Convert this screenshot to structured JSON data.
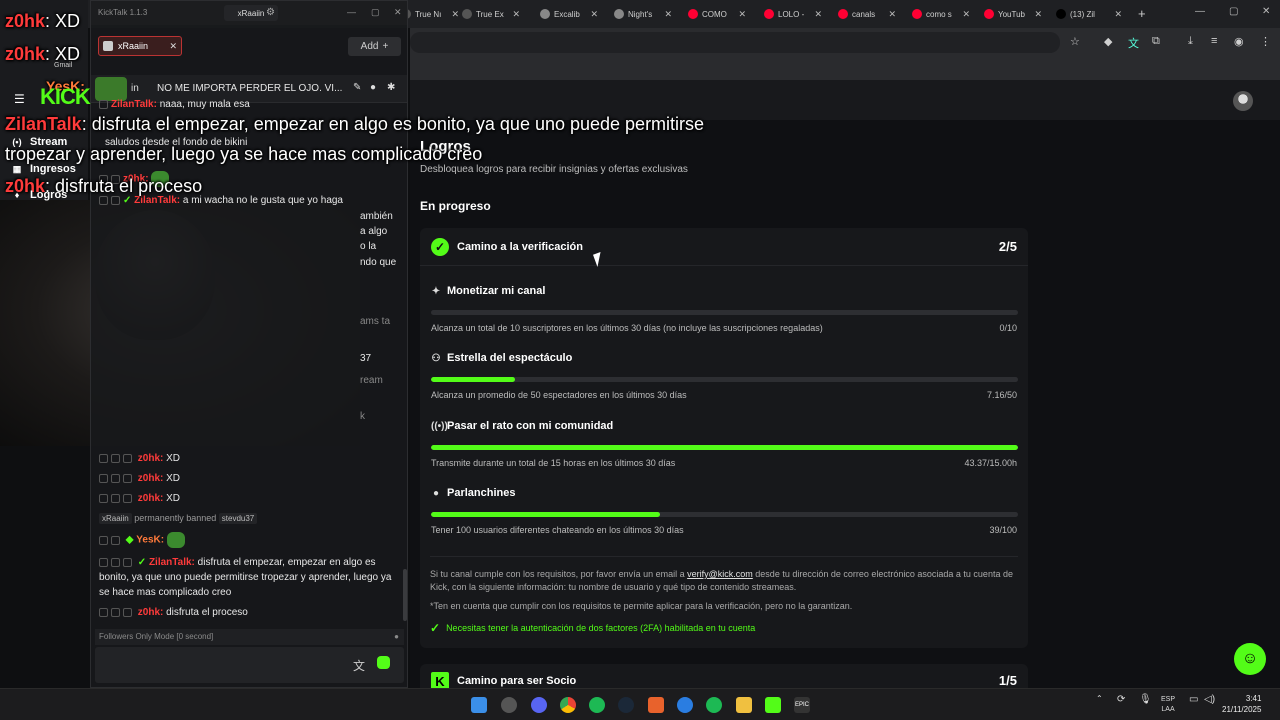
{
  "browser": {
    "tabs": [
      {
        "label": "True Nı",
        "icon": "page-icon",
        "color": "#555"
      },
      {
        "label": "True Ex",
        "icon": "page-icon",
        "color": "#555"
      },
      {
        "label": "Excalib",
        "icon": "page-icon",
        "color": "#888"
      },
      {
        "label": "Night's",
        "icon": "page-icon",
        "color": "#888"
      },
      {
        "label": "COMO",
        "icon": "youtube-icon",
        "color": "#ff0033"
      },
      {
        "label": "LOLO -",
        "icon": "youtube-icon",
        "color": "#ff0033"
      },
      {
        "label": "canals",
        "icon": "youtube-icon",
        "color": "#ff0033"
      },
      {
        "label": "como s",
        "icon": "youtube-icon",
        "color": "#ff0033"
      },
      {
        "label": "YouTub",
        "icon": "youtube-icon",
        "color": "#ff0033"
      },
      {
        "label": "(13) Zil",
        "icon": "x-icon",
        "color": "#000000"
      }
    ],
    "new_tab": "+"
  },
  "kick_page": {
    "title": "Logros",
    "subtitle": "Desbloquea logros para recibir insignias y ofertas exclusivas",
    "section": "En progreso",
    "card": {
      "title": "Camino a la verificación",
      "count": "2/5",
      "achievements": [
        {
          "icon": "sparkle-icon",
          "glyph": "✦",
          "title": "Monetizar mi canal",
          "desc": "Alcanza un total de 10 suscriptores en los últimos 30 días (no incluye las suscripciones regaladas)",
          "value": "0/10",
          "progress": 0.0
        },
        {
          "icon": "users-icon",
          "glyph": "⚇",
          "title": "Estrella del espectáculo",
          "desc": "Alcanza un promedio de 50 espectadores en los últimos 30 días",
          "value": "7.16/50",
          "progress": 0.1432
        },
        {
          "icon": "broadcast-icon",
          "glyph": "((•))",
          "title": "Pasar el rato con mi comunidad",
          "desc": "Transmite durante un total de 15 horas en los últimos 30 días",
          "value": "43.37/15.00h",
          "progress": 1.0
        },
        {
          "icon": "chat-icon",
          "glyph": "●",
          "title": "Parlanchines",
          "desc": "Tener 100 usuarios diferentes chateando en los últimos 30 días",
          "value": "39/100",
          "progress": 0.39
        }
      ],
      "info_1a": "Si tu canal cumple con los requisitos, por favor envía un email a ",
      "info_email": "verify@kick.com",
      "info_1b": " desde tu dirección de correo electrónico asociada a tu cuenta de Kick, con la siguiente información: tu nombre de usuario y qué tipo de contenido streameas.",
      "info_2": "*Ten en cuenta que cumplir con los requisitos te permite aplicar para la verificación, pero no la garantizan.",
      "twofa": "Necesitas tener la autenticación de dos factores (2FA) habilitada en tu cuenta"
    },
    "card2": {
      "title": "Camino para ser Socio",
      "count": "1/5"
    },
    "accent": "#53fc18"
  },
  "kicktalk": {
    "version": "KickTalk 1.1.3",
    "user_tab": "xRaaiin",
    "channel_tab": "xRaaiin",
    "add_label": "Add",
    "pinned": "NO ME IMPORTA PERDER EL OJO. VI...",
    "pinned_prefix": "in",
    "messages": {
      "m1_user": "ZilanTalk:",
      "m1_text": "naaa, muy mala esa",
      "m2_text": "saludos desde el fondo de bikini",
      "m3_user": "z0hk:",
      "m4_user": "ZilanTalk:",
      "m4_text": "a mi wacha no le gusta que yo haga",
      "frag_1": "ambién",
      "frag_2": "a algo",
      "frag_3": "o la",
      "frag_4": "ndo que",
      "frag_5": "ams ta",
      "frag_6": "37",
      "frag_7": "ream",
      "frag_8": "k",
      "xd_user": "z0hk:",
      "xd_text": "XD",
      "ban_mod": "xRaaiin",
      "ban_text": "permanently banned",
      "ban_target": "stevdu37",
      "yesk_user": "YesK:",
      "zt_user": "ZilanTalk:",
      "zt_text": "disfruta el empezar, empezar en algo es bonito, ya que uno puede permitirse tropezar y aprender, luego ya se hace mas complicado creo",
      "last_user": "z0hk:",
      "last_text": "disfruta el proceso"
    },
    "input_hint": "Followers Only Mode [0 second]"
  },
  "overlay": {
    "xd1_user": "z0hk",
    "xd1_text": ": XD",
    "xd2_user": "z0hk",
    "xd2_text": ": XD",
    "gmail": "Gmail",
    "yesk": "YesK:",
    "kick": "KICK",
    "zilan_user": "ZilanTalk",
    "zilan_text": ": disfruta el empezar, empezar en algo es bonito, ya que uno puede permitirse",
    "zilan_text2": "tropezar y aprender, luego ya se hace mas complicado creo",
    "last_user": "z0hk",
    "last_text": ": disfruta el proceso",
    "nav": [
      {
        "label": "Stream",
        "glyph": "(•)"
      },
      {
        "label": "Ingresos",
        "glyph": "▦"
      },
      {
        "label": "Logros",
        "glyph": "♦"
      }
    ]
  },
  "taskbar": {
    "lang": "ESP",
    "lang2": "LAA",
    "time": "3:41",
    "date": "21/11/2025"
  }
}
